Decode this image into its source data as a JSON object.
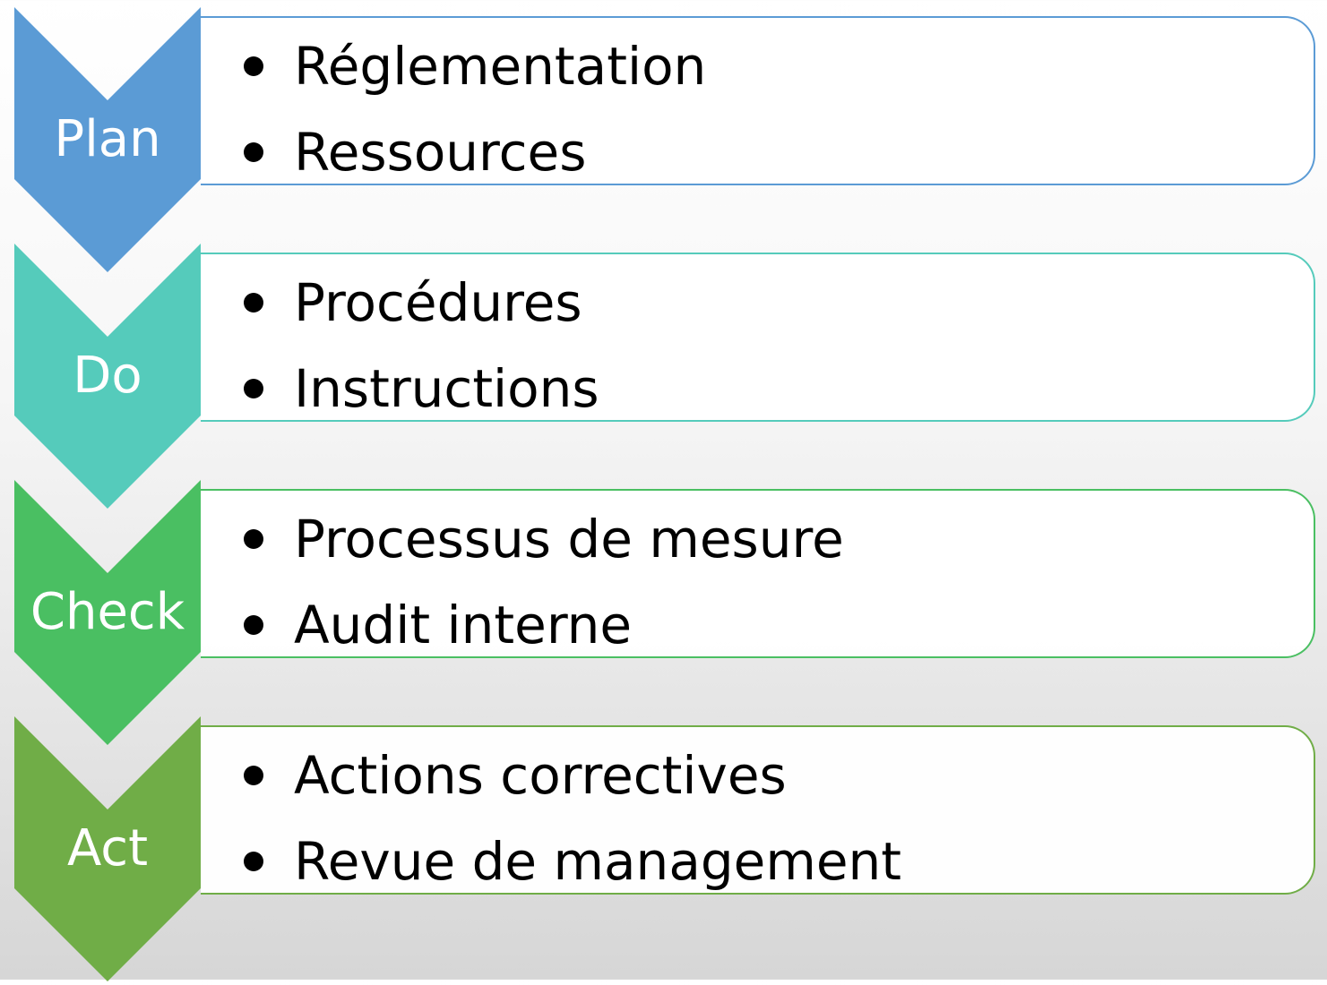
{
  "stages": [
    {
      "label": "Plan",
      "color": "#5b9bd5",
      "items": [
        "Réglementation",
        "Ressources"
      ]
    },
    {
      "label": "Do",
      "color": "#55cbbb",
      "items": [
        "Procédures",
        "Instructions"
      ]
    },
    {
      "label": "Check",
      "color": "#4abf62",
      "items": [
        "Processus de mesure",
        "Audit interne"
      ]
    },
    {
      "label": "Act",
      "color": "#70ad47",
      "items": [
        "Actions correctives",
        "Revue de management"
      ]
    }
  ]
}
